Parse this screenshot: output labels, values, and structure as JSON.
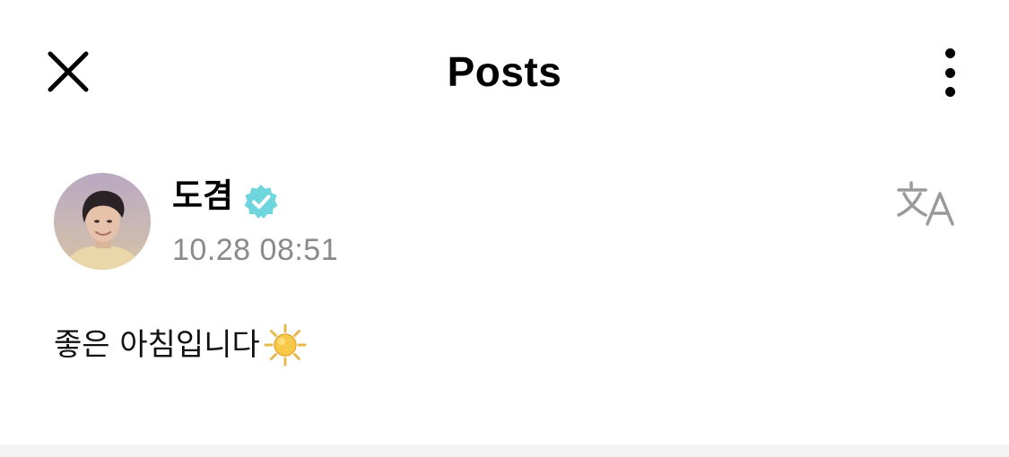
{
  "header": {
    "title": "Posts",
    "close_icon": "close-icon",
    "more_icon": "more-vertical-icon"
  },
  "post": {
    "author": {
      "name": "도겸",
      "verified": true,
      "verified_color": "#6ed6dd",
      "avatar_icon": "avatar"
    },
    "timestamp": "10.28 08:51",
    "translate_icon": "translate-icon",
    "text": "좋은 아침입니다",
    "emoji": "sun-icon"
  },
  "colors": {
    "background": "#ffffff",
    "timestamp": "#8a8a8a",
    "translate_icon": "#9a9a9a",
    "divider": "#f4f4f4"
  }
}
